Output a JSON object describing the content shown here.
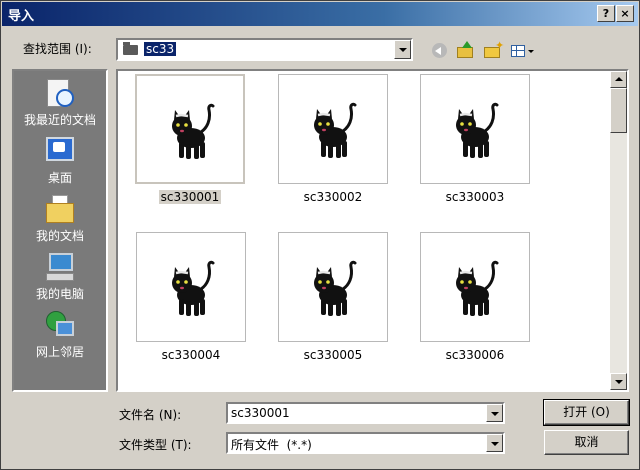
{
  "window": {
    "title": "导入",
    "help_glyph": "?",
    "close_glyph": "×"
  },
  "lookin": {
    "label": "查找范围 (I):",
    "value": "sc33"
  },
  "places": [
    {
      "label": "我最近的文档",
      "icon": "recent-docs-icon"
    },
    {
      "label": "桌面",
      "icon": "desktop-icon"
    },
    {
      "label": "我的文档",
      "icon": "my-docs-icon"
    },
    {
      "label": "我的电脑",
      "icon": "my-computer-icon"
    },
    {
      "label": "网上邻居",
      "icon": "network-icon"
    }
  ],
  "files": [
    {
      "name": "sc330001",
      "selected": true
    },
    {
      "name": "sc330002"
    },
    {
      "name": "sc330003"
    },
    {
      "name": "sc330004"
    },
    {
      "name": "sc330005"
    },
    {
      "name": "sc330006"
    }
  ],
  "filename": {
    "label": "文件名 (N):",
    "value": "sc330001"
  },
  "filetype": {
    "label": "文件类型 (T):",
    "value": "所有文件  (*.*)"
  },
  "buttons": {
    "open": "打开 (O)",
    "cancel": "取消"
  },
  "colors": {
    "titlebar": "#0a246a",
    "dialog_bg": "#d4d0c8",
    "places_bg": "#7a7a7a",
    "selection": "#0a246a"
  }
}
